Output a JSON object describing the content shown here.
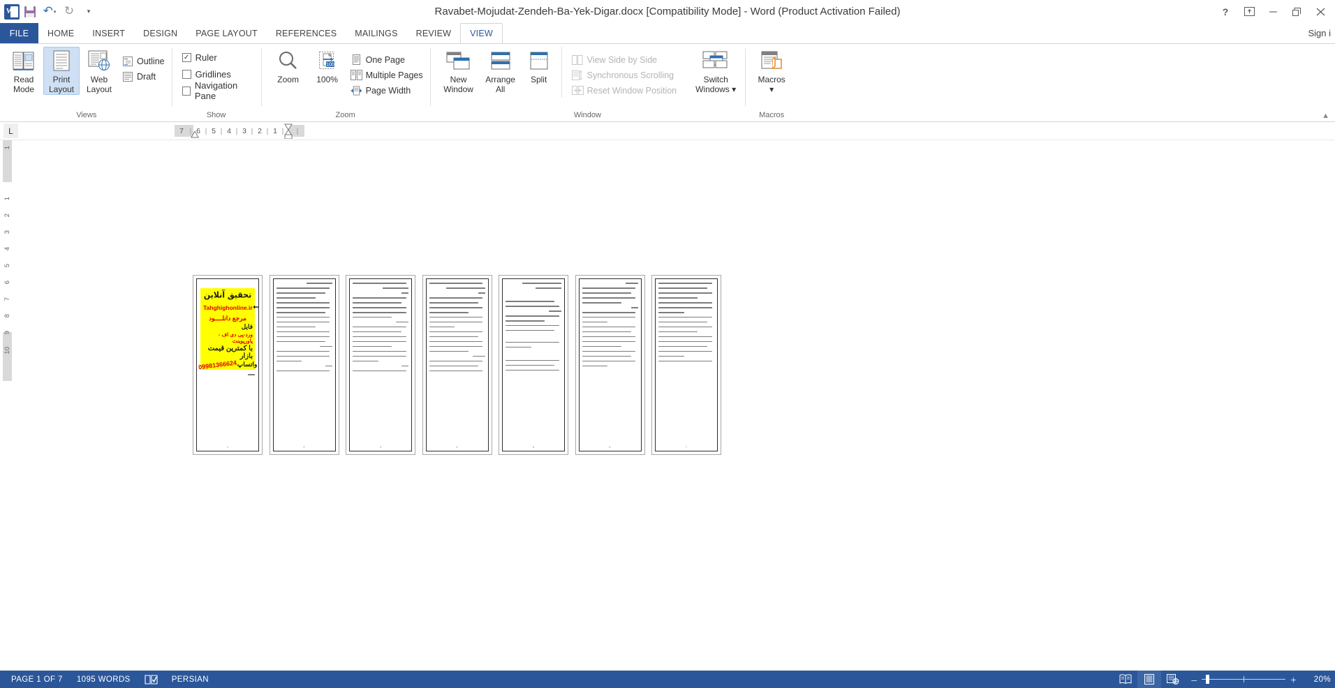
{
  "titlebar": {
    "doc_title": "Ravabet-Mojudat-Zendeh-Ba-Yek-Digar.docx [Compatibility Mode] - Word (Product Activation Failed)",
    "qat": [
      {
        "name": "word-logo",
        "label": "W"
      },
      {
        "name": "save-icon",
        "label": "Save"
      },
      {
        "name": "undo-icon",
        "label": "Undo"
      },
      {
        "name": "redo-icon",
        "label": "Redo"
      },
      {
        "name": "customize-qat-icon",
        "label": "Customize Quick Access Toolbar"
      }
    ],
    "help_label": "?",
    "ribbon_display_label": "Ribbon Display Options",
    "minimize_label": "Minimize",
    "restore_label": "Restore Down",
    "close_label": "Close",
    "signin_label": "Sign i"
  },
  "tabs": {
    "file": "FILE",
    "items": [
      "HOME",
      "INSERT",
      "DESIGN",
      "PAGE LAYOUT",
      "REFERENCES",
      "MAILINGS",
      "REVIEW",
      "VIEW"
    ],
    "active": "VIEW"
  },
  "ribbon": {
    "groups": [
      {
        "label": "Views",
        "buttons": [
          {
            "name": "read-mode-button",
            "label_top": "Read",
            "label_bottom": "Mode",
            "selected": false
          },
          {
            "name": "print-layout-button",
            "label_top": "Print",
            "label_bottom": "Layout",
            "selected": true
          },
          {
            "name": "web-layout-button",
            "label_top": "Web",
            "label_bottom": "Layout",
            "selected": false
          }
        ],
        "small": [
          {
            "name": "outline-button",
            "label": "Outline"
          },
          {
            "name": "draft-button",
            "label": "Draft"
          }
        ]
      },
      {
        "label": "Show",
        "checks": [
          {
            "name": "ruler-checkbox",
            "label": "Ruler",
            "checked": true
          },
          {
            "name": "gridlines-checkbox",
            "label": "Gridlines",
            "checked": false
          },
          {
            "name": "navigation-pane-checkbox",
            "label": "Navigation Pane",
            "checked": false
          }
        ]
      },
      {
        "label": "Zoom",
        "buttons": [
          {
            "name": "zoom-button",
            "label_top": "Zoom",
            "label_bottom": "",
            "selected": false
          },
          {
            "name": "zoom-100-button",
            "label_top": "100%",
            "label_bottom": "",
            "selected": false
          }
        ],
        "small": [
          {
            "name": "one-page-button",
            "label": "One Page"
          },
          {
            "name": "multiple-pages-button",
            "label": "Multiple Pages"
          },
          {
            "name": "page-width-button",
            "label": "Page Width"
          }
        ]
      },
      {
        "label": "Window",
        "buttons": [
          {
            "name": "new-window-button",
            "label_top": "New",
            "label_bottom": "Window",
            "selected": false
          },
          {
            "name": "arrange-all-button",
            "label_top": "Arrange",
            "label_bottom": "All",
            "selected": false
          },
          {
            "name": "split-button",
            "label_top": "Split",
            "label_bottom": "",
            "selected": false
          }
        ],
        "small": [
          {
            "name": "view-side-by-side-button",
            "label": "View Side by Side",
            "disabled": true
          },
          {
            "name": "synchronous-scrolling-button",
            "label": "Synchronous Scrolling",
            "disabled": true
          },
          {
            "name": "reset-window-position-button",
            "label": "Reset Window Position",
            "disabled": true
          }
        ],
        "buttons2": [
          {
            "name": "switch-windows-button",
            "label_top": "Switch",
            "label_bottom": "Windows ▾",
            "selected": false
          }
        ]
      },
      {
        "label": "Macros",
        "buttons": [
          {
            "name": "macros-button",
            "label_top": "Macros",
            "label_bottom": "▾",
            "selected": false
          }
        ]
      }
    ]
  },
  "ruler": {
    "tab_selector": "L",
    "horizontal_marks": [
      "7",
      "6",
      "5",
      "4",
      "3",
      "2",
      "1"
    ],
    "vertical_marks": [
      "1",
      "1",
      "2",
      "3",
      "4",
      "5",
      "6",
      "7",
      "8",
      "9",
      "10"
    ]
  },
  "document": {
    "page_count": 7,
    "pages": [
      {
        "number": "1",
        "type": "flyer"
      },
      {
        "number": "2",
        "type": "text"
      },
      {
        "number": "3",
        "type": "text"
      },
      {
        "number": "4",
        "type": "text"
      },
      {
        "number": "5",
        "type": "text"
      },
      {
        "number": "6",
        "type": "text"
      },
      {
        "number": "7",
        "type": "text"
      }
    ],
    "flyer": {
      "line1": "تحقیق آنلاین",
      "line2": "Tahghighonline.ir",
      "line3": "مرجع دانلــــود",
      "line4": "فایل",
      "line5": "ورد-پی دی اف - پاورپوینت",
      "line6": "با کمترین قیمت بازار",
      "line7_phone": "09981366624",
      "line7_label": "واتساپ",
      "background_color": "#ffff00",
      "accent_color": "#e00000"
    }
  },
  "status": {
    "page_indicator": "PAGE 1 OF 7",
    "word_count": "1095 WORDS",
    "proofing_icon": "spelling-check-icon",
    "language": "PERSIAN",
    "view_buttons": [
      {
        "name": "read-mode-view-button",
        "label": "Read Mode",
        "active": false
      },
      {
        "name": "print-layout-view-button",
        "label": "Print Layout",
        "active": true
      },
      {
        "name": "web-layout-view-button",
        "label": "Web Layout",
        "active": false
      }
    ],
    "zoom_out_label": "–",
    "zoom_in_label": "+",
    "zoom_level": "20%"
  }
}
